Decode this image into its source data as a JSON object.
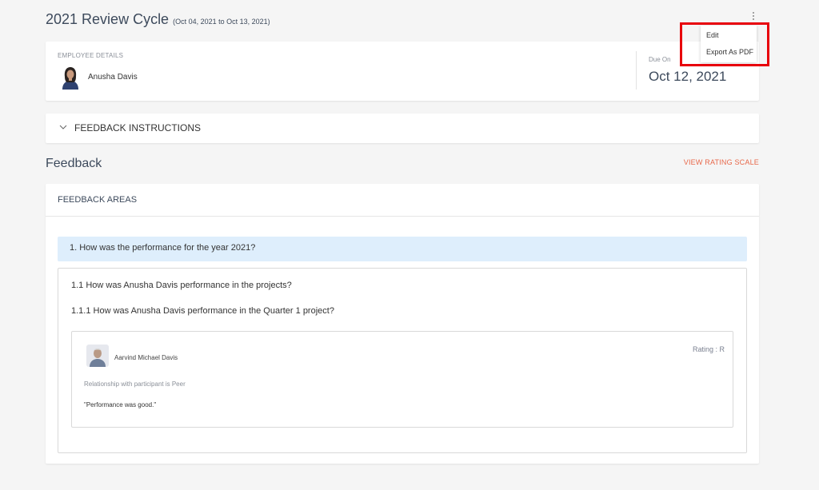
{
  "header": {
    "title": "2021 Review Cycle",
    "dates": "(Oct 04, 2021 to Oct 13, 2021)"
  },
  "menu": {
    "items": [
      "Edit",
      "Export As PDF"
    ]
  },
  "employee": {
    "section_label": "EMPLOYEE DETAILS",
    "name": "Anusha Davis",
    "due_label": "Due On",
    "due_date": "Oct 12, 2021"
  },
  "instructions": {
    "label": "FEEDBACK INSTRUCTIONS"
  },
  "feedback": {
    "title": "Feedback",
    "rating_scale_link": "VIEW RATING SCALE",
    "areas_label": "FEEDBACK AREAS",
    "question": "1. How was the performance for the year 2021?",
    "sub_question": "1.1 How was Anusha Davis performance in the projects?",
    "sub_sub_question": "1.1.1 How was Anusha Davis performance in the Quarter 1 project?",
    "response": {
      "reviewer": "Aarvind Michael Davis",
      "rating": "Rating : R",
      "relationship": "Relationship with participant is Peer",
      "comment": "\"Performance was good.\""
    }
  },
  "colors": {
    "accent_link": "#e8684a",
    "highlight_box": "#e8000b",
    "question_bg": "#deeefc"
  }
}
